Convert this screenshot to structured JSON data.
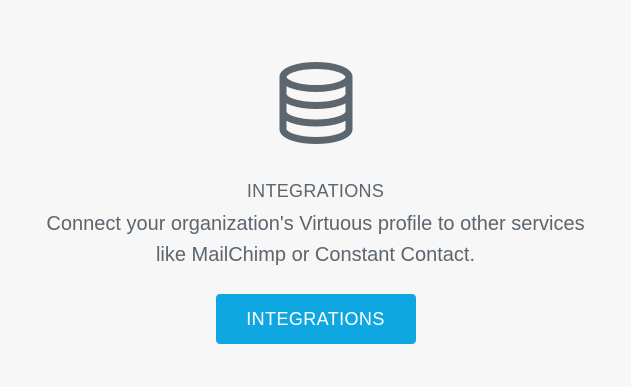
{
  "integrations": {
    "icon": "database-icon",
    "icon_color": "#5c666f",
    "title": "INTEGRATIONS",
    "description_line1": "Connect your organization's Virtuous profile to other services",
    "description_line2": "like MailChimp or Constant Contact.",
    "button_label": "INTEGRATIONS",
    "button_color": "#0fa7e1"
  }
}
